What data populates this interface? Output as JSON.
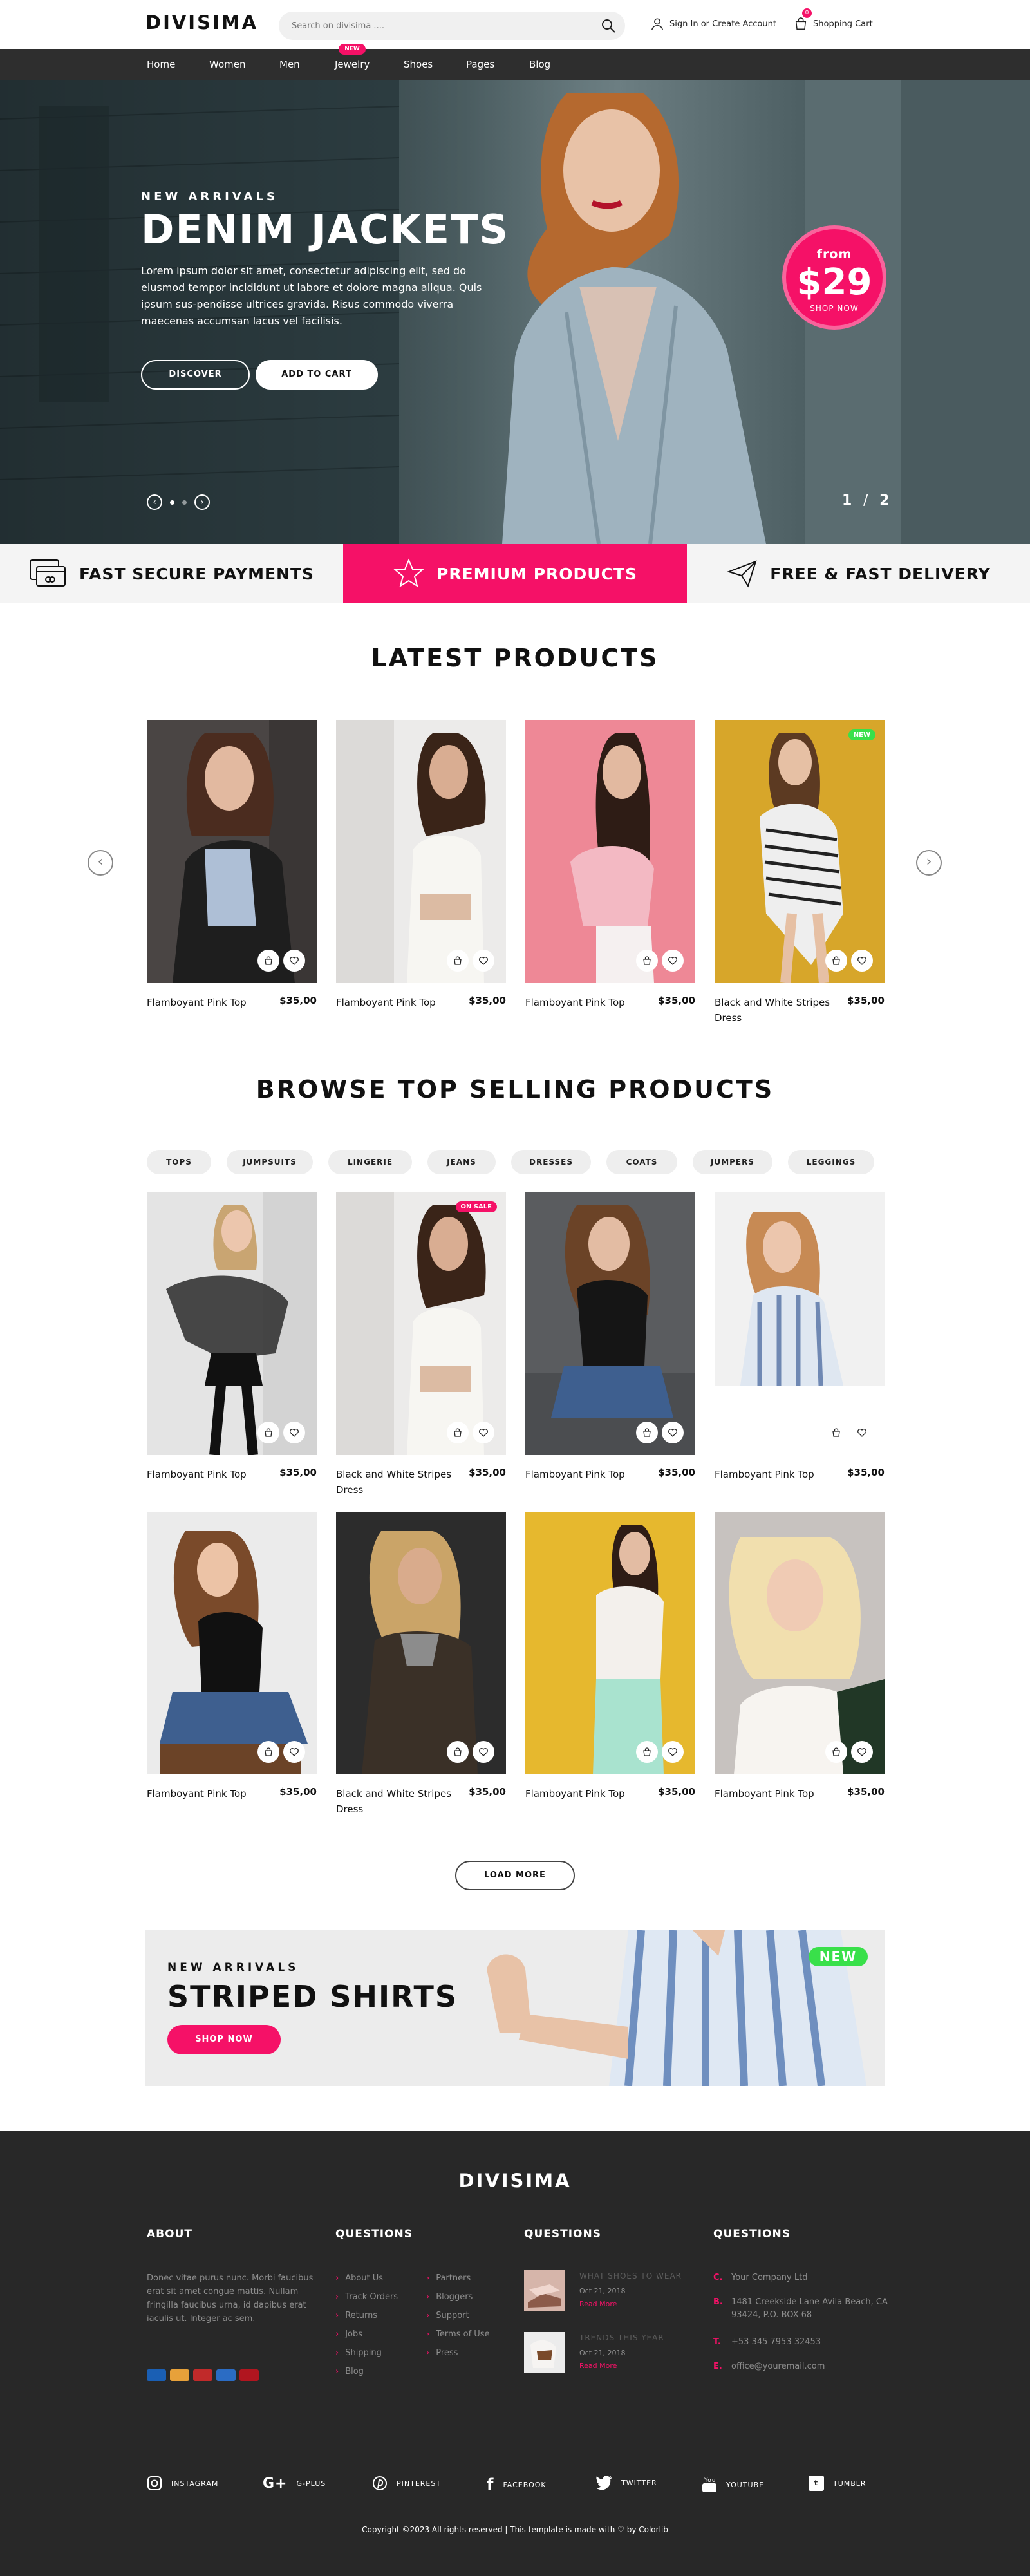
{
  "header": {
    "logo": "DIVISIMA",
    "search_placeholder": "Search on divisima ....",
    "account_label": "Sign In or Create Account",
    "cart_label": "Shopping Cart",
    "cart_count": "0"
  },
  "nav": {
    "items": [
      "Home",
      "Women",
      "Men",
      "Jewelry",
      "Shoes",
      "Pages",
      "Blog"
    ],
    "new_badge": "NEW"
  },
  "hero": {
    "kicker": "NEW ARRIVALS",
    "title": "DENIM JACKETS",
    "text": "Lorem ipsum dolor sit amet, consectetur adipiscing elit, sed do eiusmod tempor incididunt ut labore et dolore magna aliqua. Quis ipsum sus-pendisse ultrices gravida. Risus commodo viverra maecenas accumsan lacus vel facilisis.",
    "btn_discover": "DISCOVER",
    "btn_add": "ADD TO CART",
    "price_from": "from",
    "price_value": "$29",
    "price_shop": "SHOP NOW",
    "slide_current": "1",
    "slide_sep": "/",
    "slide_total": "2"
  },
  "features": {
    "payments": "FAST SECURE PAYMENTS",
    "premium": "PREMIUM PRODUCTS",
    "delivery": "FREE & FAST DELIVERY"
  },
  "latest": {
    "title": "LATEST PRODUCTS",
    "products": [
      {
        "name": "Flamboyant Pink Top",
        "price": "$35,00"
      },
      {
        "name": "Flamboyant Pink Top",
        "price": "$35,00"
      },
      {
        "name": "Flamboyant Pink Top",
        "price": "$35,00"
      },
      {
        "name": "Black and White Stripes Dress",
        "price": "$35,00",
        "badge": "NEW"
      }
    ]
  },
  "browse": {
    "title": "BROWSE TOP SELLING PRODUCTS",
    "categories": [
      "TOPS",
      "JUMPSUITS",
      "LINGERIE",
      "JEANS",
      "DRESSES",
      "COATS",
      "JUMPERS",
      "LEGGINGS"
    ],
    "products": [
      {
        "name": "Flamboyant Pink Top",
        "price": "$35,00"
      },
      {
        "name": "Black and White Stripes Dress",
        "price": "$35,00",
        "badge": "ON SALE"
      },
      {
        "name": "Flamboyant Pink Top",
        "price": "$35,00"
      },
      {
        "name": "Flamboyant Pink Top",
        "price": "$35,00"
      },
      {
        "name": "Flamboyant Pink Top",
        "price": "$35,00"
      },
      {
        "name": "Black and White Stripes Dress",
        "price": "$35,00"
      },
      {
        "name": "Flamboyant Pink Top",
        "price": "$35,00"
      },
      {
        "name": "Flamboyant Pink Top",
        "price": "$35,00"
      }
    ],
    "load_more": "LOAD MORE"
  },
  "banner": {
    "kicker": "NEW ARRIVALS",
    "title": "STRIPED SHIRTS",
    "button": "SHOP NOW",
    "badge": "NEW"
  },
  "footer": {
    "logo": "DIVISIMA",
    "about_title": "ABOUT",
    "about_text": "Donec vitae purus nunc. Morbi faucibus erat sit amet congue mattis. Nullam fringilla faucibus urna, id dapibus erat iaculis ut. Integer ac sem.",
    "questions1_title": "QUESTIONS",
    "questions1_col1": [
      "About Us",
      "Track Orders",
      "Returns",
      "Jobs",
      "Shipping",
      "Blog"
    ],
    "questions1_col2": [
      "Partners",
      "Bloggers",
      "Support",
      "Terms of Use",
      "Press"
    ],
    "questions2_title": "QUESTIONS",
    "blog": [
      {
        "title": "What shoes to wear",
        "date": "Oct 21, 2018",
        "more": "Read More"
      },
      {
        "title": "Trends this year",
        "date": "Oct 21, 2018",
        "more": "Read More"
      }
    ],
    "questions3_title": "QUESTIONS",
    "contact": [
      {
        "icon": "C.",
        "text": "Your Company Ltd"
      },
      {
        "icon": "B.",
        "text": "1481 Creekside Lane Avila Beach, CA 93424, P.O. BOX 68"
      },
      {
        "icon": "T.",
        "text": "+53 345 7953 32453"
      },
      {
        "icon": "E.",
        "text": "office@youremail.com"
      }
    ],
    "social": [
      "INSTAGRAM",
      "G-PLUS",
      "PINTEREST",
      "FACEBOOK",
      "TWITTER",
      "YOUTUBE",
      "TUMBLR"
    ],
    "copyright": "Copyright ©2023 All rights reserved | This template is made with ♡ by Colorlib"
  },
  "colors": {
    "accent": "#f51167",
    "dark": "#282828",
    "nav": "#2e2e2e",
    "new_badge": "#39e04a"
  }
}
